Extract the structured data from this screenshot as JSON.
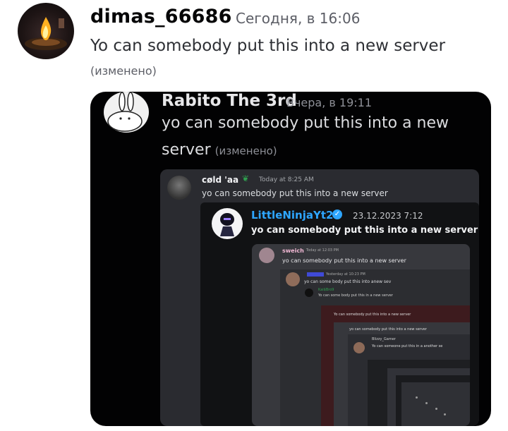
{
  "message": {
    "author": "dimas_66686",
    "timestamp": "Сегодня, в 16:06",
    "text": "Yo can somebody put this into a new server",
    "edited": "(изменено)"
  },
  "screenshot": {
    "level1": {
      "author": "Rabito The 3rd",
      "timestamp": "Вчера, в 19:11",
      "text_line1": "yo can somebody put this into a new",
      "text_line2": "server",
      "edited": "(изменено)"
    },
    "level2": {
      "author": "cøld 'aa",
      "badge_icon": "leaf-emoji-icon",
      "timestamp": "Today at 8:25 AM",
      "text": "yo can somebody put this into a new server"
    },
    "level3": {
      "author": "LittleNinjaYt21",
      "timestamp": "23.12.2023 7:12",
      "text": "yo can somebody put this into a new server"
    },
    "level4": {
      "author": "sweich",
      "timestamp": "Today at 12:03 PM",
      "text": "yo can somebody put this into a new server"
    },
    "level5": {
      "timestamp": "Yesterday at 10:23 PM",
      "text": "yo can some body put this into anew sev",
      "author2": "Kai$Bro9",
      "text2": "Yo can some body put this in a new server"
    },
    "level6": {
      "text": "Yo can somebody put this into a new server"
    },
    "level7": {
      "text": "yo can somebody put this into a new server"
    },
    "level8": {
      "author": "Blizzy_Gamer",
      "text": "Yo can someone put this in a another se"
    }
  },
  "colors": {
    "background": "#ffffff",
    "screenshot_bg": "#020203",
    "verified": "#2ea6ff"
  }
}
